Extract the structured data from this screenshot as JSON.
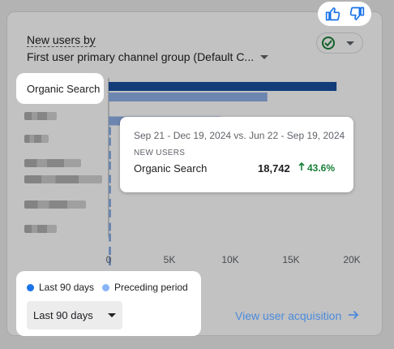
{
  "card": {
    "title": "New users by",
    "subtitle": "First user primary channel group (Default C..."
  },
  "feedback": {
    "like_icon": "thumb-up-icon",
    "dislike_icon": "thumb-down-icon"
  },
  "status": {
    "icon": "check-circle-icon"
  },
  "chart_data": {
    "type": "bar",
    "orientation": "horizontal",
    "categories": [
      "Organic Search",
      "",
      "",
      "",
      "",
      "",
      ""
    ],
    "series": [
      {
        "name": "Last 90 days",
        "color": "#1a4fa0",
        "values": [
          18742,
          null,
          null,
          null,
          null,
          null,
          null
        ]
      },
      {
        "name": "Preceding period",
        "color": "#8fb0e6",
        "values": [
          13050,
          9200,
          null,
          null,
          null,
          null,
          null
        ]
      }
    ],
    "x_ticks": [
      "0",
      "5K",
      "10K",
      "15K",
      "20K"
    ],
    "xlim": [
      0,
      20000
    ],
    "legend_position": "bottom-left"
  },
  "tooltip": {
    "date_range": "Sep 21 - Dec 19, 2024 vs. Jun 22 - Sep 19, 2024",
    "metric": "NEW USERS",
    "channel": "Organic Search",
    "value": "18,742",
    "change": "43.6%",
    "change_color": "#188038"
  },
  "legend": {
    "current": "Last 90 days",
    "current_color": "#1a73e8",
    "previous": "Preceding period",
    "previous_color": "#8ab4f8"
  },
  "date_selector": {
    "value": "Last 90 days"
  },
  "footer": {
    "link": "View user acquisition"
  }
}
